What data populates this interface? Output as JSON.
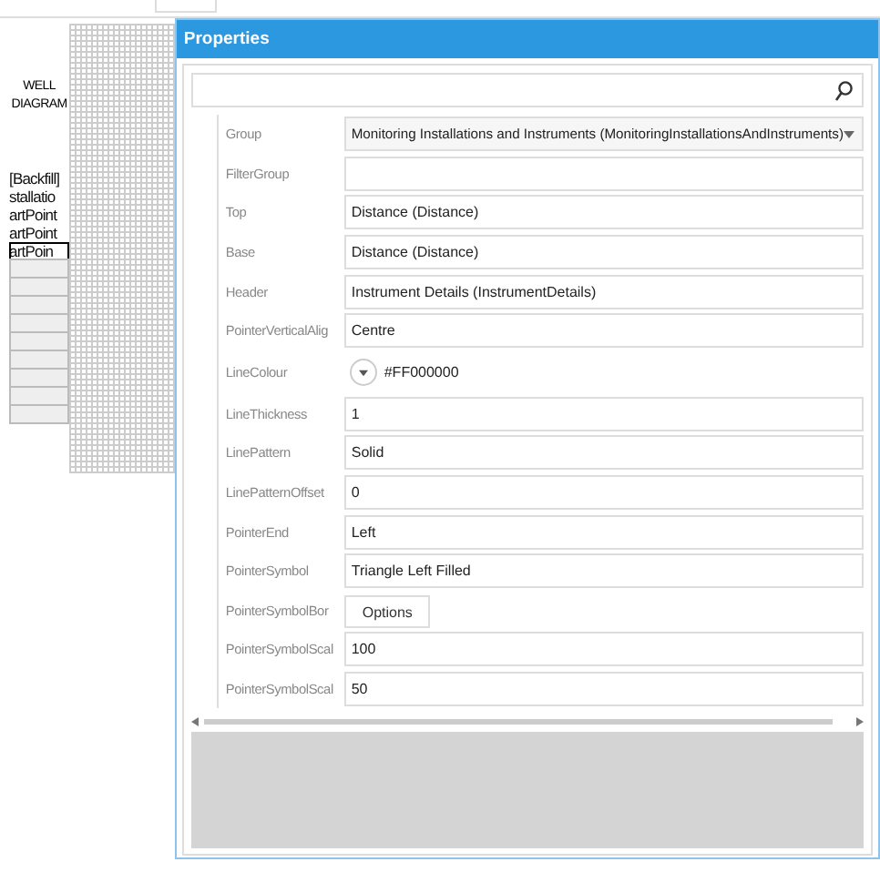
{
  "diagram": {
    "title": "WELL DIAGRAM",
    "items": [
      {
        "text": "[Backfill]",
        "selected": false
      },
      {
        "text": "stallatio",
        "selected": false
      },
      {
        "text": "artPoint",
        "selected": false
      },
      {
        "text": "artPoint",
        "selected": false
      },
      {
        "text": "artPoin",
        "selected": true
      }
    ]
  },
  "window": {
    "title": "Properties"
  },
  "properties": [
    {
      "label": "Group",
      "kind": "dropdown",
      "value": "Monitoring Installations and Instruments (MonitoringInstallationsAndInstruments)"
    },
    {
      "label": "FilterGroup",
      "kind": "text"
    },
    {
      "label": "Top",
      "kind": "text",
      "value": "Distance (Distance)"
    },
    {
      "label": "Base",
      "kind": "text",
      "value": "Distance (Distance)"
    },
    {
      "label": "Header",
      "kind": "text",
      "value": "Instrument Details (InstrumentDetails)"
    },
    {
      "label": "PointerVerticalAlig",
      "kind": "text",
      "value": "Centre"
    },
    {
      "label": "LineColour",
      "kind": "color",
      "value": "#FF000000"
    },
    {
      "label": "LineThickness",
      "kind": "text",
      "value": "1"
    },
    {
      "label": "LinePattern",
      "kind": "text",
      "value": "Solid"
    },
    {
      "label": "LinePatternOffset",
      "kind": "text",
      "value": "0"
    },
    {
      "label": "PointerEnd",
      "kind": "text",
      "value": "Left"
    },
    {
      "label": "PointerSymbol",
      "kind": "text",
      "value": "Triangle Left Filled"
    },
    {
      "label": "PointerSymbolBor",
      "kind": "button",
      "value": "Options"
    },
    {
      "label": "PointerSymbolScal",
      "kind": "text",
      "value": "100"
    },
    {
      "label": "PointerSymbolScal",
      "kind": "text",
      "value": "50"
    }
  ]
}
